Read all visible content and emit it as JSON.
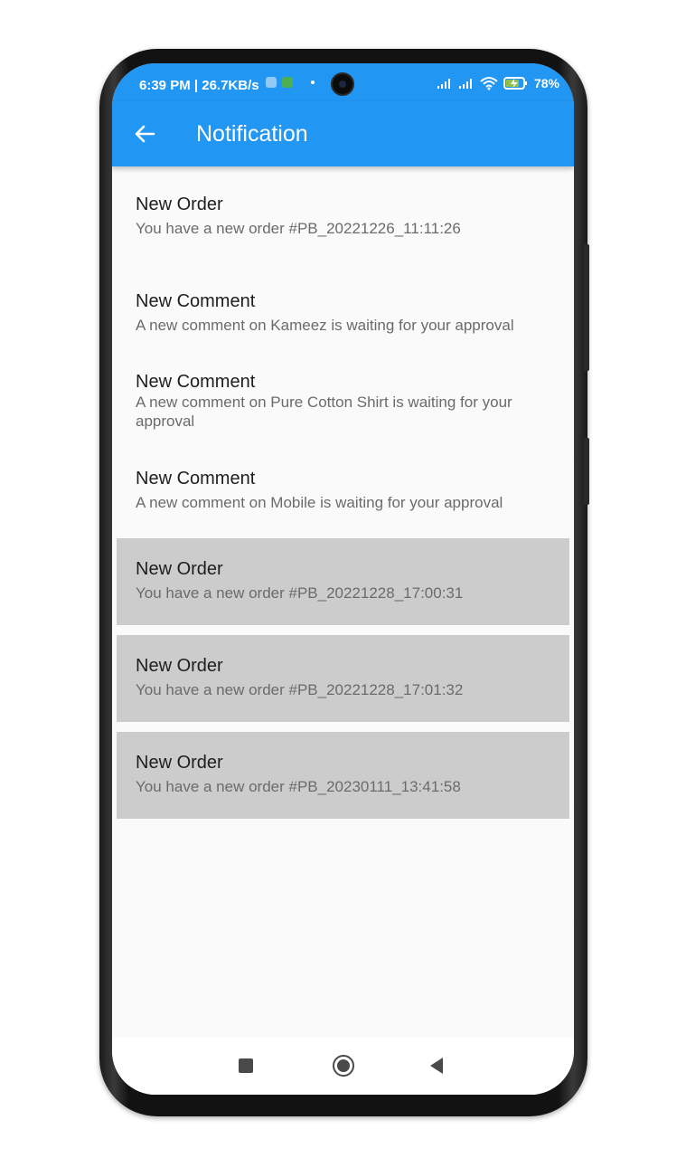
{
  "status_bar": {
    "time_text": "6:39 PM | 26.7KB/s",
    "battery_text": "78%",
    "icons": [
      "sync-icon",
      "android-icon",
      "dot-icon",
      "signal-icon",
      "signal-icon",
      "wifi-icon",
      "battery-charging-icon"
    ]
  },
  "app_bar": {
    "title": "Notification",
    "back_icon": "arrow-left-icon",
    "color": "#2196f3"
  },
  "notifications": [
    {
      "title": "New Order",
      "body": "You have a new order #PB_20221226_11:11:26",
      "highlighted": false
    },
    {
      "title": "New Comment",
      "body": "A new comment on Kameez is waiting for your approval",
      "highlighted": false
    },
    {
      "title": "New Comment",
      "body": "A new comment on Pure Cotton Shirt  is waiting for your approval",
      "highlighted": false
    },
    {
      "title": "New Comment",
      "body": "A new comment on Mobile  is waiting for your approval",
      "highlighted": false
    },
    {
      "title": "New Order",
      "body": "You have a new order #PB_20221228_17:00:31",
      "highlighted": true
    },
    {
      "title": "New Order",
      "body": "You have a new order #PB_20221228_17:01:32",
      "highlighted": true
    },
    {
      "title": "New Order",
      "body": "You have a new order #PB_20230111_13:41:58",
      "highlighted": true
    }
  ],
  "highlight_color": "#cccccc",
  "nav_bar": {
    "icons": [
      "recent-apps-square-icon",
      "home-circle-icon",
      "back-triangle-icon"
    ]
  }
}
